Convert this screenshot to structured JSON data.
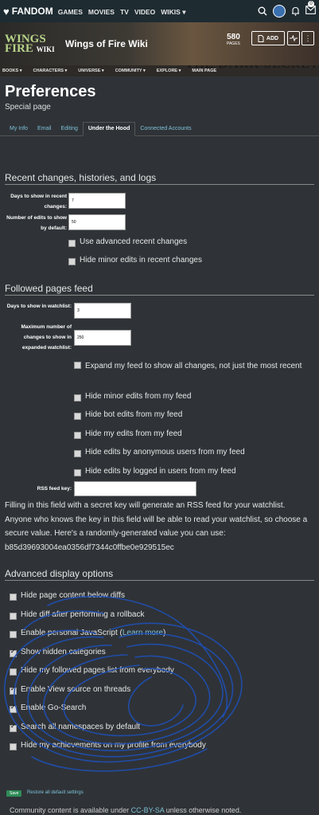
{
  "topbar": {
    "brand": "FANDOM",
    "nav": [
      "GAMES",
      "MOVIES",
      "TV",
      "VIDEO",
      "WIKIS ▾"
    ],
    "notification_count": "0"
  },
  "wiki": {
    "logo_line1": "WINGS",
    "logo_line2": "FIRE",
    "logo_wiki": "WIKI",
    "title": "Wings of Fire Wiki",
    "pages_count": "580",
    "pages_label": "PAGES",
    "add_label": "ADD",
    "banner_text": "THE DARK SECRET",
    "subnav": [
      "BOOKS ▾",
      "CHARACTERS ▾",
      "UNIVERSE ▾",
      "COMMUNITY ▾",
      "EXPLORE ▾",
      "MAIN PAGE"
    ]
  },
  "page": {
    "title": "Preferences",
    "subtitle": "Special page"
  },
  "tabs": [
    {
      "label": "My Info"
    },
    {
      "label": "Email"
    },
    {
      "label": "Editing"
    },
    {
      "label": "Under the Hood"
    },
    {
      "label": "Connected Accounts"
    }
  ],
  "recent": {
    "heading": "Recent changes, histories, and logs",
    "days_label": "Days to show in recent changes:",
    "days_value": "7",
    "edits_label": "Number of edits to show by default:",
    "edits_value": "50",
    "checks": [
      {
        "label": "Use advanced recent changes",
        "checked": true
      },
      {
        "label": "Hide minor edits in recent changes",
        "checked": false
      }
    ]
  },
  "feed": {
    "heading": "Followed pages feed",
    "days_label": "Days to show in watchlist:",
    "days_value": "3",
    "max_label": "Maximum number of changes to show in expanded watchlist:",
    "max_value": "250",
    "checks": [
      {
        "label": "Expand my feed to show all changes, not just the most recent",
        "checked": false
      },
      {
        "label": "Hide minor edits from my feed",
        "checked": false
      },
      {
        "label": "Hide bot edits from my feed",
        "checked": false
      },
      {
        "label": "Hide my edits from my feed",
        "checked": false
      },
      {
        "label": "Hide edits by anonymous users from my feed",
        "checked": false
      },
      {
        "label": "Hide edits by logged in users from my feed",
        "checked": false
      }
    ],
    "rss_label": "RSS feed key:",
    "rss_value": "",
    "rss_note": "Filling in this field with a secret key will generate an RSS feed for your watchlist. Anyone who knows the key in this field will be able to read your watchlist, so choose a secure value. Here's a randomly-generated value you can use: b85d39693004ea0356df7344c0ffbe0e929515ec"
  },
  "advanced": {
    "heading": "Advanced display options",
    "checks": [
      {
        "label": "Hide page content below diffs",
        "checked": false
      },
      {
        "label": "Hide diff after performing a rollback",
        "checked": false
      },
      {
        "label": "Enable personal JavaScript (",
        "link": "Learn more",
        "after": ")",
        "checked": false
      },
      {
        "label": "Show hidden categories",
        "checked": true
      },
      {
        "label": "Hide my followed pages list from everybody",
        "checked": false
      },
      {
        "label": "Enable View source on threads",
        "checked": true
      },
      {
        "label": "Enable Go-Search",
        "checked": true
      },
      {
        "label": "Search all namespaces by default",
        "checked": true
      },
      {
        "label": "Hide my achievements on my profile from everybody",
        "checked": false
      }
    ]
  },
  "actions": {
    "save": "Save",
    "restore": "Restore all default settings"
  },
  "footer": {
    "text_before": "Community content is available under ",
    "license": "CC-BY-SA",
    "text_after": " unless otherwise noted."
  },
  "colors": {
    "link": "#7ec1d8",
    "scribble": "#1f4fb5",
    "save": "#2e8b57"
  }
}
